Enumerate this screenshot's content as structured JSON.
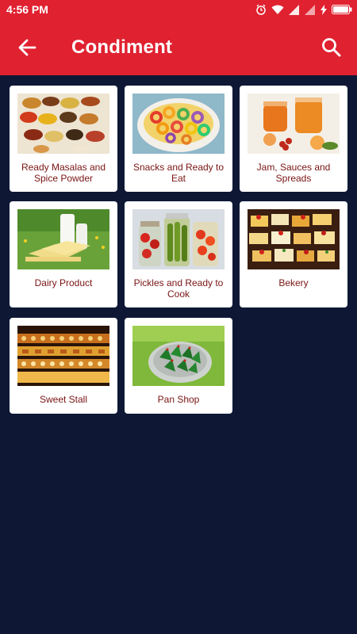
{
  "status_bar": {
    "time": "4:56 PM",
    "icons": [
      "alarm-icon",
      "wifi-icon",
      "signal-icon",
      "signal-icon",
      "charging-icon",
      "battery-icon"
    ]
  },
  "app_bar": {
    "title": "Condiment",
    "back_icon": "arrow-left-icon",
    "search_icon": "search-icon",
    "color": "#e02130"
  },
  "colors": {
    "background": "#0e1835",
    "card": "#ffffff",
    "label_text": "#7a1414"
  },
  "categories": [
    {
      "label": "Ready Masalas and Spice Powder",
      "image": "spices-photo"
    },
    {
      "label": "Snacks and Ready to Eat",
      "image": "cereal-loops-photo"
    },
    {
      "label": "Jam, Sauces and Spreads",
      "image": "jam-jars-photo"
    },
    {
      "label": "Dairy Product",
      "image": "milk-cheese-photo"
    },
    {
      "label": "Pickles and Ready to Cook",
      "image": "pickle-jars-photo"
    },
    {
      "label": "Bekery",
      "image": "pastries-photo"
    },
    {
      "label": "Sweet Stall",
      "image": "sweets-stall-photo"
    },
    {
      "label": "Pan Shop",
      "image": "paan-photo"
    }
  ]
}
